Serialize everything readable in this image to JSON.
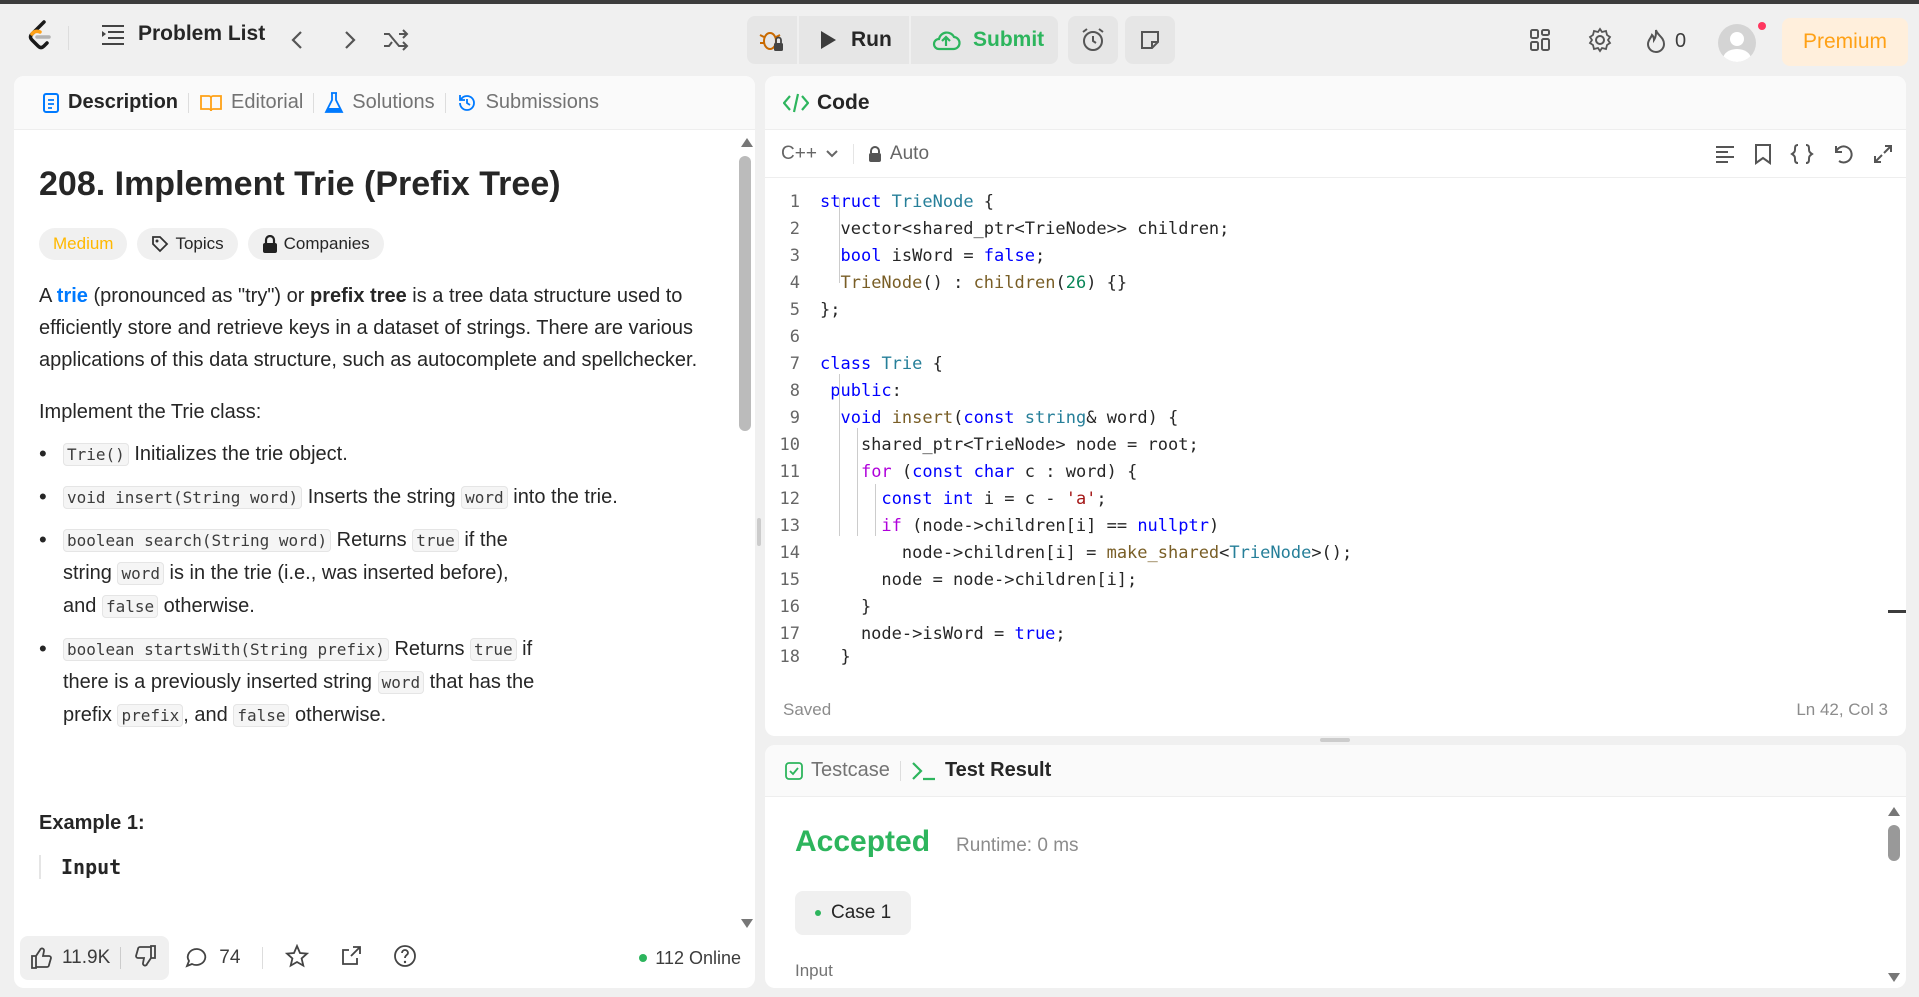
{
  "topbar": {
    "problem_list": "Problem List",
    "run": "Run",
    "submit": "Submit",
    "streak_count": "0",
    "premium": "Premium"
  },
  "left_tabs": [
    "Description",
    "Editorial",
    "Solutions",
    "Submissions"
  ],
  "problem": {
    "title": "208. Implement Trie (Prefix Tree)",
    "difficulty": "Medium",
    "topics": "Topics",
    "companies": "Companies",
    "intro": {
      "a": "A ",
      "trie": "trie",
      "pron": " (pronounced as \"try\") or ",
      "prefix_tree": "prefix tree",
      "rest": " is a tree data structure used to efficiently store and retrieve keys in a dataset of strings. There are various applications of this data structure, such as autocomplete and spellchecker."
    },
    "implement": "Implement the Trie class:",
    "b1": {
      "code": "Trie()",
      "text": " Initializes the trie object."
    },
    "b2": {
      "code": "void insert(String word)",
      "t1": " Inserts the string ",
      "c2": "word",
      "t2": " into the trie."
    },
    "b3": {
      "code": "boolean search(String word)",
      "t1": " Returns ",
      "c2": "true",
      "t2": " if the string ",
      "c3": "word",
      "t3": " is in the trie (i.e., was inserted before), and ",
      "c4": "false",
      "t4": " otherwise."
    },
    "b4": {
      "code": "boolean startsWith(String prefix)",
      "t1": " Returns ",
      "c2": "true",
      "t2": " if there is a previously inserted string ",
      "c3": "word",
      "t3": " that has the prefix ",
      "c4": "prefix",
      "t4": ", and ",
      "c5": "false",
      "t5": " otherwise."
    },
    "example_title": "Example 1:",
    "input_label": "Input"
  },
  "left_footer": {
    "likes": "11.9K",
    "comments": "74",
    "online": "112 Online"
  },
  "code_panel": {
    "title": "Code",
    "language": "C++",
    "auto": "Auto",
    "status": "Saved",
    "cursor": "Ln 42, Col 3"
  },
  "code_lines": [
    "1",
    "2",
    "3",
    "4",
    "5",
    "6",
    "7",
    "8",
    "9",
    "10",
    "11",
    "12",
    "13",
    "14",
    "15",
    "16",
    "17",
    "18"
  ],
  "bottom_panel": {
    "tabs": [
      "Testcase",
      "Test Result"
    ],
    "result": "Accepted",
    "runtime": "Runtime: 0 ms",
    "case": "Case 1",
    "input_label": "Input"
  },
  "colors": {
    "accent_green": "#2db55d",
    "medium": "#ffb800",
    "premium": "#ffa116",
    "link_blue": "#007aff"
  }
}
